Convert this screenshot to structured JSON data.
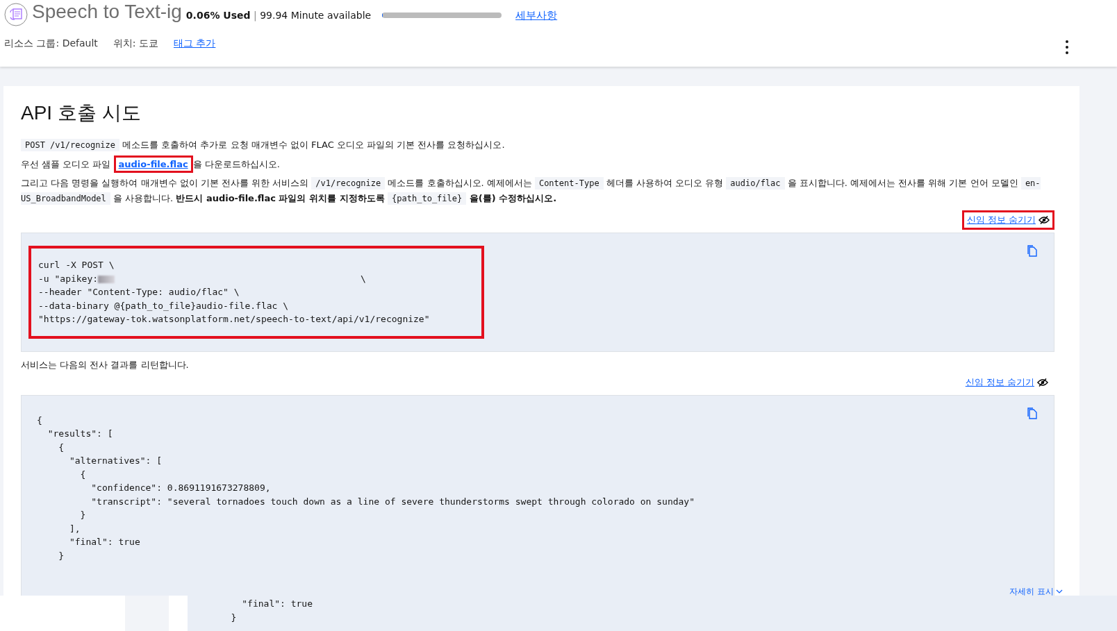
{
  "header": {
    "title": "Speech to Text-ig",
    "usage": {
      "used": "0.06% Used",
      "separator": "|",
      "available": "99.94 Minute available",
      "level": 0.0006,
      "details_link": "세부사항"
    },
    "meta": [
      {
        "label": "리소스 그룹:",
        "value": "Default"
      },
      {
        "label": "위치:",
        "value": "도쿄"
      }
    ],
    "add_tag_link": "태그 추가"
  },
  "section": {
    "heading": "API 호출 시도",
    "intro": [
      {
        "kind": "code",
        "text": "POST /v1/recognize"
      },
      {
        "kind": "text",
        "text": " 메소드를 호출하여 추가로 요청 매개변수 없이 FLAC 오디오 파일의 기본 전사를 요청하십시오."
      }
    ],
    "download": {
      "before": "우선 샘플 오디오 파일 ",
      "link": "audio-file.flac",
      "after": "을 다운로드하십시오.",
      "highlighted": true
    },
    "instructions": [
      {
        "kind": "text",
        "text": "그리고 다음 명령을 실행하여 매개변수 없이 기본 전사를 위한 서비스의 "
      },
      {
        "kind": "code",
        "text": "/v1/recognize"
      },
      {
        "kind": "text",
        "text": " 메소드를 호출하십시오. 예제에서는 "
      },
      {
        "kind": "code",
        "text": "Content-Type"
      },
      {
        "kind": "text",
        "text": " 헤더를 사용하여 오디오 유형 "
      },
      {
        "kind": "code",
        "text": "audio/flac"
      },
      {
        "kind": "text",
        "text": " 을 표시합니다. 예제에서는 전사를 위해 기본 언어 모델인 "
      },
      {
        "kind": "code",
        "text": "en-US_BroadbandModel"
      },
      {
        "kind": "text",
        "text": " 을 사용합니다. "
      },
      {
        "kind": "bold",
        "text": "반드시 audio-file.flac 파일의 위치를 지정하도록 "
      },
      {
        "kind": "code",
        "text": "{path_to_file}"
      },
      {
        "kind": "bold",
        "text": " 을(를) 수정하십시오."
      }
    ],
    "request": {
      "hide_link": "신임 정보 숨기기",
      "highlighted": true,
      "lines": [
        {
          "kind": "plain",
          "text": "curl -X POST \\"
        },
        {
          "kind": "redacted",
          "text": "-u \"apikey:",
          "tail": "\\"
        },
        {
          "kind": "plain",
          "text": "--header \"Content-Type: audio/flac\" \\"
        },
        {
          "kind": "plain",
          "text": "--data-binary @{path_to_file}audio-file.flac \\"
        },
        {
          "kind": "plain",
          "text": "\"https://gateway-tok.watsonplatform.net/speech-to-text/api/v1/recognize\""
        }
      ]
    },
    "response_intro": "서비스는 다음의 전사 결과를 리턴합니다.",
    "response": {
      "hide_link": "신임 정보 숨기기",
      "highlighted": false,
      "lines": [
        "{",
        "  \"results\": [",
        "    {",
        "      \"alternatives\": [",
        "        {",
        "          \"confidence\": 0.8691191673278809,",
        "          \"transcript\": \"several tornadoes touch down as a line of severe thunderstorms swept through colorado on sunday\"",
        "        }",
        "      ],",
        "      \"final\": true",
        "    }"
      ],
      "show_more": "자세히 표시"
    }
  },
  "overlay": {
    "lines": [
      "          \"final\": true",
      "        }"
    ]
  }
}
